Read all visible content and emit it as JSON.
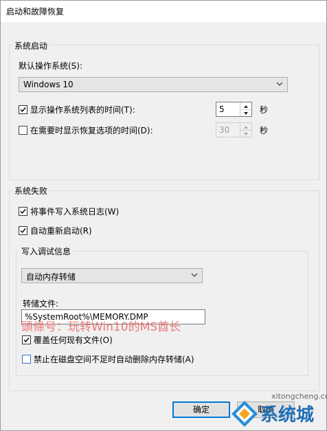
{
  "window": {
    "title": "启动和故障恢复"
  },
  "startup": {
    "group_label": "系统启动",
    "default_os_label": "默认操作系统(S):",
    "default_os_value": "Windows 10",
    "show_list": {
      "label": "显示操作系统列表的时间(T):",
      "checked": true,
      "value": "5",
      "unit": "秒"
    },
    "show_recovery": {
      "label": "在需要时显示恢复选项的时间(D):",
      "checked": false,
      "value": "30",
      "unit": "秒"
    }
  },
  "failure": {
    "group_label": "系统失败",
    "write_event": {
      "label": "将事件写入系统日志(W)",
      "checked": true
    },
    "auto_restart": {
      "label": "自动重新启动(R)",
      "checked": true
    }
  },
  "debug": {
    "group_label": "写入调试信息",
    "type_value": "自动内存转储",
    "dump_file_label": "转储文件:",
    "dump_file_value": "%SystemRoot%\\MEMORY.DMP",
    "overwrite": {
      "label": "覆盖任何现有文件(O)",
      "checked": true
    },
    "disable_auto_delete": {
      "label": "禁止在磁盘空间不足时自动删除内存转储(A)",
      "checked": false
    }
  },
  "buttons": {
    "ok": "确定",
    "cancel": "取消"
  },
  "watermark": {
    "text": "頭條号：玩转Win10的MS酋长",
    "site": "xitongcheng.com",
    "brand": "系统城"
  },
  "colors": {
    "accent": "#0078d7",
    "watermark": "#e83a3a"
  }
}
